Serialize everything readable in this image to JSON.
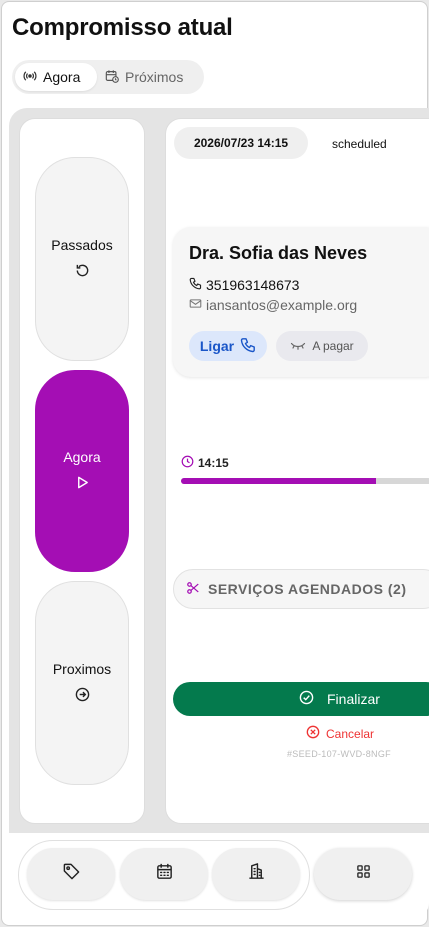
{
  "page_title": "Compromisso atual",
  "segmented": {
    "now_label": "Agora",
    "upcoming_label": "Próximos"
  },
  "sidebar": {
    "past_label": "Passados",
    "now_label": "Agora",
    "next_label": "Proximos"
  },
  "appointment": {
    "datetime": "2026/07/23 14:15",
    "status": "scheduled",
    "client_name": "Dra. Sofia das Neves",
    "phone": "351963148673",
    "email": "iansantos@example.org",
    "call_label": "Ligar",
    "payment_label": "A pagar",
    "start_time": "14:15",
    "progress": 0.78,
    "services_label": "SERVIÇOS AGENDADOS (2)",
    "finalize_label": "Finalizar",
    "cancel_label": "Cancelar",
    "seed_code": "#SEED-107-WVD-8NGF"
  },
  "colors": {
    "accent": "#a40eb4",
    "finalize": "#047a4d",
    "cancel": "#ee3333",
    "call": "#1a56c8"
  },
  "bottom_nav": {
    "icons": [
      "tag-icon",
      "calendar-icon",
      "building-icon",
      "grid-icon"
    ]
  }
}
